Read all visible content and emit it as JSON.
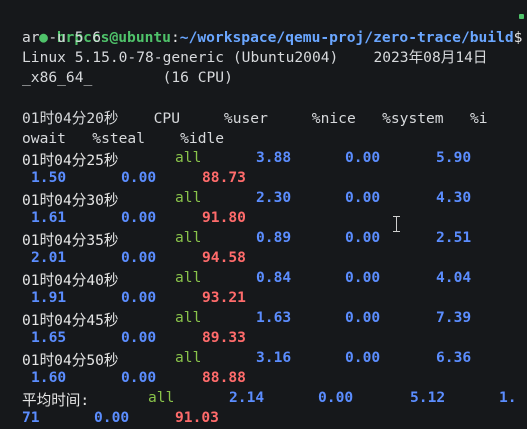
{
  "prompt": {
    "bullet": "●",
    "user_host": "hrpccs@ubuntu",
    "sep": ":",
    "path": "~/workspace/qemu-proj/zero-trace/build",
    "symbol": "$",
    "cmd_line1": " s",
    "cmd_line2": "ar -u 5 6"
  },
  "sysinfo": {
    "line1": "Linux 5.15.0-78-generic (Ubuntu2004)    2023年08月14日",
    "line2": "_x86_64_        (16 CPU)"
  },
  "table": {
    "header_line1": "01时04分20秒    CPU     %user     %nice   %system   %i",
    "header_line2": "owait   %steal    %idle",
    "rows": [
      {
        "time": "01时04分25秒",
        "cpu": "all",
        "user": "3.88",
        "nice": "0.00",
        "system": "5.90",
        "iowait": "1.50",
        "steal": "0.00",
        "idle": "88.73"
      },
      {
        "time": "01时04分30秒",
        "cpu": "all",
        "user": "2.30",
        "nice": "0.00",
        "system": "4.30",
        "iowait": "1.61",
        "steal": "0.00",
        "idle": "91.80"
      },
      {
        "time": "01时04分35秒",
        "cpu": "all",
        "user": "0.89",
        "nice": "0.00",
        "system": "2.51",
        "iowait": "2.01",
        "steal": "0.00",
        "idle": "94.58"
      },
      {
        "time": "01时04分40秒",
        "cpu": "all",
        "user": "0.84",
        "nice": "0.00",
        "system": "4.04",
        "iowait": "1.91",
        "steal": "0.00",
        "idle": "93.21"
      },
      {
        "time": "01时04分45秒",
        "cpu": "all",
        "user": "1.63",
        "nice": "0.00",
        "system": "7.39",
        "iowait": "1.65",
        "steal": "0.00",
        "idle": "89.33"
      },
      {
        "time": "01时04分50秒",
        "cpu": "all",
        "user": "3.16",
        "nice": "0.00",
        "system": "6.36",
        "iowait": "1.60",
        "steal": "0.00",
        "idle": "88.88"
      }
    ],
    "average": {
      "label": "平均时间:",
      "cpu": "all",
      "user": "2.14",
      "nice": "0.00",
      "system": "5.12",
      "iowait_head": "1.",
      "iowait_tail": "71",
      "steal": "0.00",
      "idle": "91.03"
    }
  },
  "colors": {
    "background": "#16181b",
    "prompt": "#4fc36a",
    "path": "#6aa6ff",
    "value_blue": "#5b8dff",
    "idle_red": "#ff6b6b",
    "cpu_green": "#89c34a"
  }
}
